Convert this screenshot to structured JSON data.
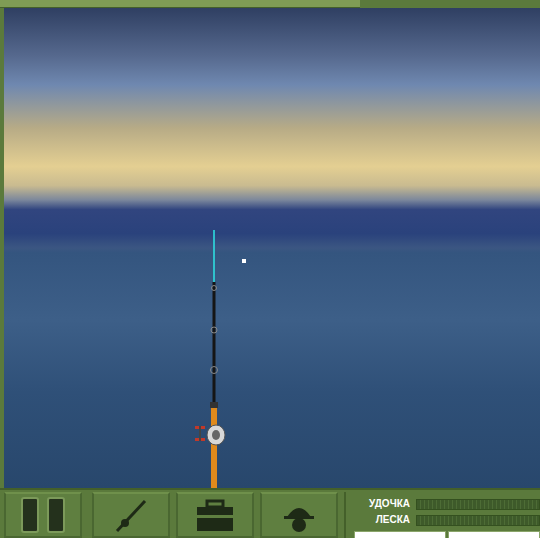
{
  "gauges": [
    {
      "label": "УДОЧКА",
      "level": 0
    },
    {
      "label": "ЛЕСКА",
      "level": 0
    }
  ]
}
